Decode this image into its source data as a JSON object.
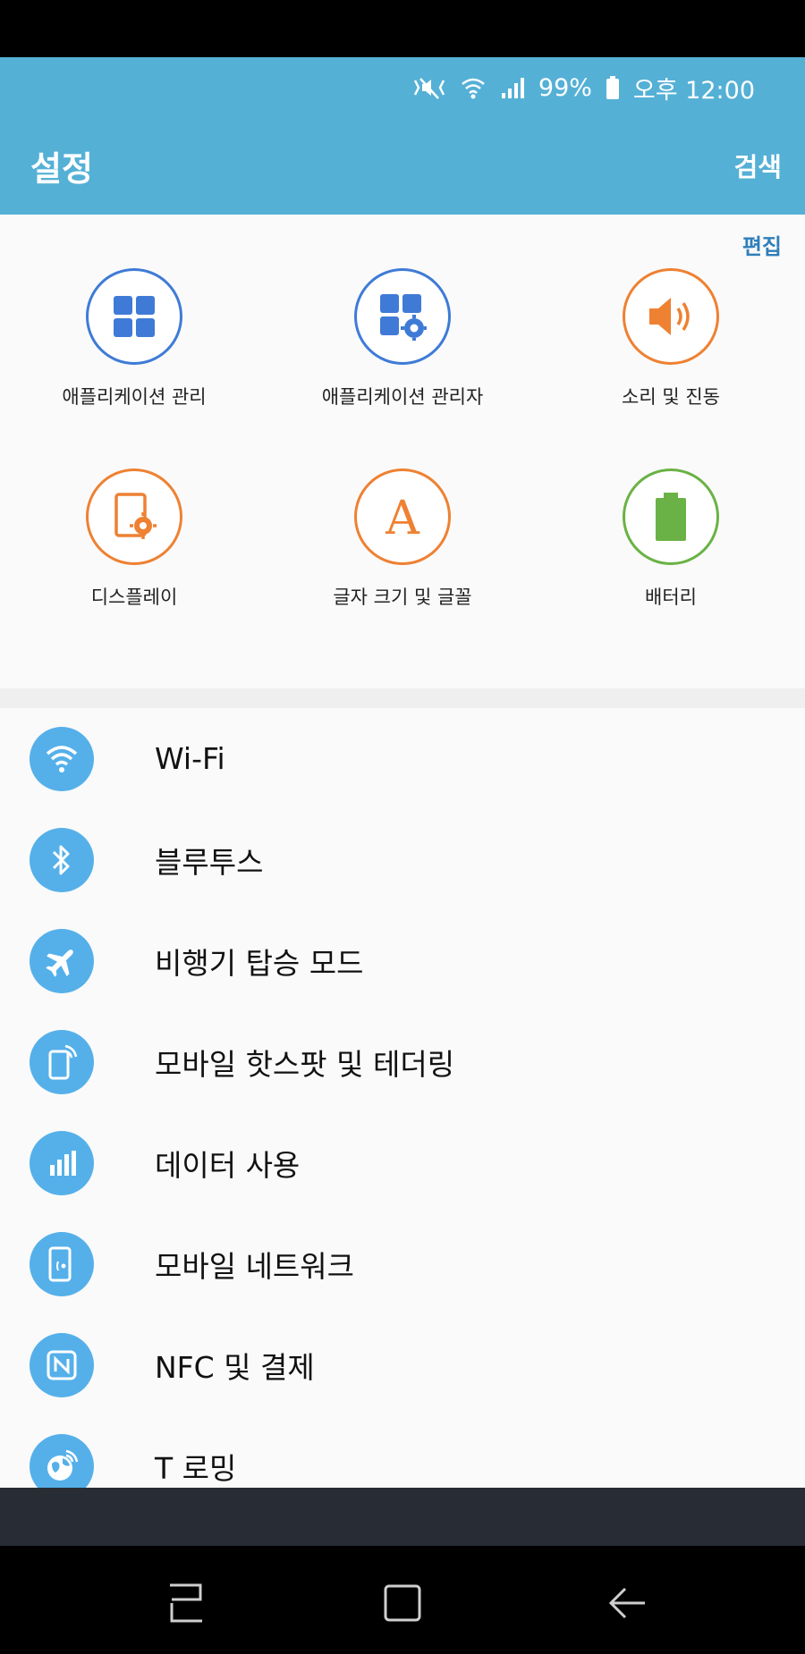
{
  "status_bar": {
    "battery": "99%",
    "time": "오후 12:00"
  },
  "header": {
    "title": "설정",
    "search_label": "검색"
  },
  "edit_label": "편집",
  "quick_settings": [
    {
      "label": "애플리케이션 관리",
      "icon": "apps-grid-icon"
    },
    {
      "label": "애플리케이션 관리자",
      "icon": "apps-settings-icon"
    },
    {
      "label": "소리 및 진동",
      "icon": "speaker-icon"
    },
    {
      "label": "디스플레이",
      "icon": "display-icon"
    },
    {
      "label": "글자 크기 및 글꼴",
      "icon": "font-icon"
    },
    {
      "label": "배터리",
      "icon": "battery-icon"
    }
  ],
  "settings_list": [
    {
      "label": "Wi-Fi",
      "icon": "wifi-icon"
    },
    {
      "label": "블루투스",
      "icon": "bluetooth-icon"
    },
    {
      "label": "비행기 탑승 모드",
      "icon": "airplane-icon"
    },
    {
      "label": "모바일 핫스팟 및 테더링",
      "icon": "hotspot-icon"
    },
    {
      "label": "데이터 사용",
      "icon": "data-usage-icon"
    },
    {
      "label": "모바일 네트워크",
      "icon": "mobile-network-icon"
    },
    {
      "label": "NFC 및 결제",
      "icon": "nfc-icon"
    },
    {
      "label": "T 로밍",
      "icon": "roaming-icon"
    }
  ],
  "colors": {
    "header": "#55b0d6",
    "icon_blue": "#55b0ea",
    "accent_orange": "#ee8132",
    "accent_green": "#6ab245",
    "link_blue": "#2f7fba"
  },
  "nav_buttons": [
    "recent-apps-icon",
    "home-icon",
    "back-icon"
  ]
}
